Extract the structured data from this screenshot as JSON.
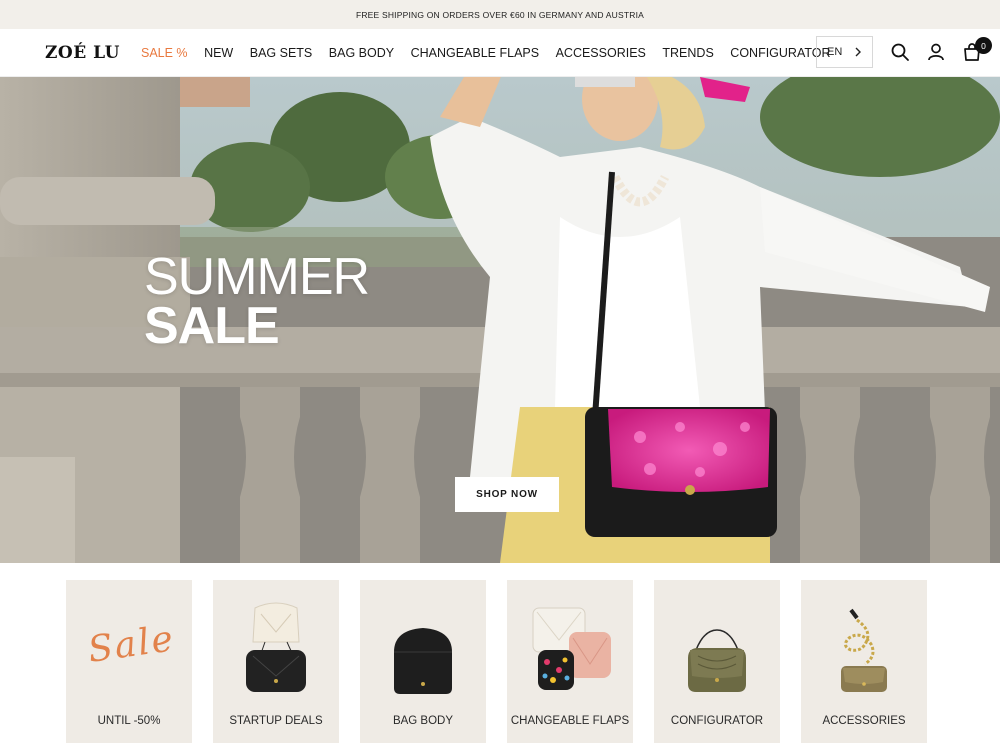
{
  "announcement": "FREE SHIPPING ON ORDERS OVER €60 IN GERMANY AND AUSTRIA",
  "brand": {
    "logo": "ZOÉ LU"
  },
  "nav": [
    {
      "label": "SALE %",
      "highlight": true
    },
    {
      "label": "NEW"
    },
    {
      "label": "BAG SETS"
    },
    {
      "label": "BAG BODY"
    },
    {
      "label": "CHANGEABLE FLAPS"
    },
    {
      "label": "ACCESSORIES"
    },
    {
      "label": "TRENDS"
    },
    {
      "label": "CONFIGURATOR"
    }
  ],
  "header_tools": {
    "language": "EN",
    "icons": [
      "search-icon",
      "account-icon",
      "cart-icon"
    ],
    "cart_count": "0"
  },
  "hero": {
    "title_line1": "SUMMER",
    "title_line2": "SALE",
    "cta": "SHOP NOW"
  },
  "categories": [
    {
      "label": "UNTIL -50%",
      "script_text": "Sale"
    },
    {
      "label": "STARTUP DEALS"
    },
    {
      "label": "BAG BODY"
    },
    {
      "label": "CHANGEABLE FLAPS"
    },
    {
      "label": "CONFIGURATOR"
    },
    {
      "label": "ACCESSORIES"
    }
  ],
  "colors": {
    "accent_sale": "#e9793f",
    "announcement_bg": "#f2efea",
    "tile_bg": "#efebe5",
    "hero_bag_flap": "#e0288f"
  }
}
